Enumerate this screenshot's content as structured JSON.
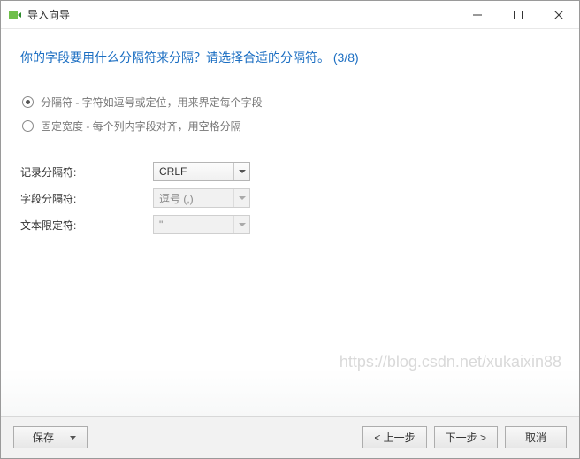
{
  "titlebar": {
    "title": "导入向导"
  },
  "heading": "你的字段要用什么分隔符来分隔？请选择合适的分隔符。  (3/8)",
  "radios": {
    "delimited": "分隔符 - 字符如逗号或定位，用来界定每个字段",
    "fixed": "固定宽度 - 每个列内字段对齐，用空格分隔"
  },
  "form": {
    "record_label": "记录分隔符:",
    "record_value": "CRLF",
    "field_label": "字段分隔符:",
    "field_value": "逗号 (,)",
    "text_label": "文本限定符:",
    "text_value": "\""
  },
  "footer": {
    "save": "保存",
    "back": "< 上一步",
    "next": "下一步 >",
    "cancel": "取消"
  },
  "watermark": "https://blog.csdn.net/xukaixin88"
}
